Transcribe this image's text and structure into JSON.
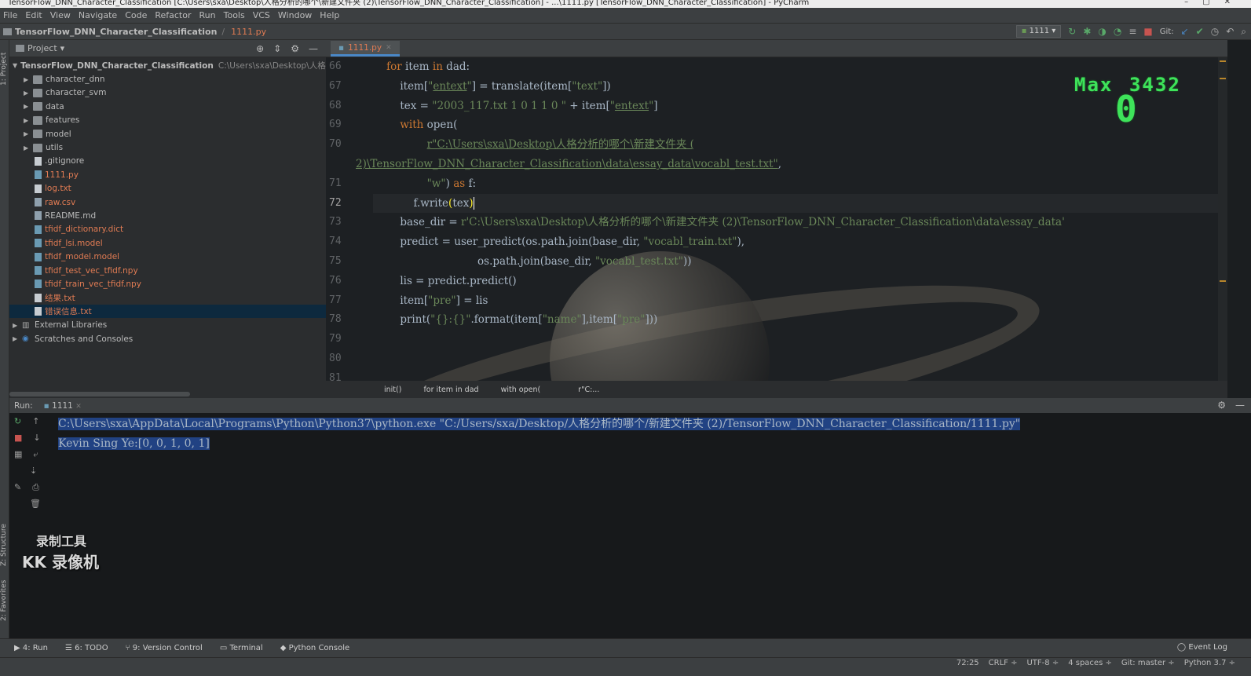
{
  "window": {
    "title": "TensorFlow_DNN_Character_Classification [C:\\Users\\sxa\\Desktop\\人格分析的哪个\\新建文件夹 (2)\\TensorFlow_DNN_Character_Classification] - ...\\1111.py [TensorFlow_DNN_Character_Classification] - PyCharm"
  },
  "menu": [
    "File",
    "Edit",
    "View",
    "Navigate",
    "Code",
    "Refactor",
    "Run",
    "Tools",
    "VCS",
    "Window",
    "Help"
  ],
  "nav": {
    "project": "TensorFlow_DNN_Character_Classification",
    "file": "1111.py",
    "run_config": "1111",
    "git_label": "Git:"
  },
  "left_strip": {
    "project_tab": "1: Project",
    "structure_tab": "Z: Structure",
    "favorites_tab": "2: Favorites"
  },
  "project_panel": {
    "header": "Project",
    "root": {
      "name": "TensorFlow_DNN_Character_Classification",
      "path": "C:\\Users\\sxa\\Desktop\\人格分析的"
    },
    "folders": [
      "character_dnn",
      "character_svm",
      "data",
      "features",
      "model",
      "utils"
    ],
    "files": [
      {
        "name": ".gitignore",
        "modified": false
      },
      {
        "name": "1111.py",
        "modified": true
      },
      {
        "name": "log.txt",
        "modified": true
      },
      {
        "name": "raw.csv",
        "modified": true
      },
      {
        "name": "README.md",
        "modified": false
      },
      {
        "name": "tfidf_dictionary.dict",
        "modified": true
      },
      {
        "name": "tfidf_lsi.model",
        "modified": true
      },
      {
        "name": "tfidf_model.model",
        "modified": true
      },
      {
        "name": "tfidf_test_vec_tfidf.npy",
        "modified": true
      },
      {
        "name": "tfidf_train_vec_tfidf.npy",
        "modified": true
      },
      {
        "name": "结果.txt",
        "modified": true
      },
      {
        "name": "错误信息.txt",
        "modified": true
      }
    ],
    "external": "External Libraries",
    "scratches": "Scratches and Consoles"
  },
  "editor": {
    "tab": "1111.py",
    "line_numbers": [
      "66",
      "67",
      "68",
      "69",
      "70",
      "",
      "71",
      "72",
      "73",
      "74",
      "75",
      "76",
      "77",
      "78",
      "79",
      "80",
      "81"
    ],
    "breadcrumbs": [
      "init()",
      "for item in dad",
      "with open(",
      "r\"C:..."
    ]
  },
  "overlay": {
    "max_label": "Max",
    "max_value": "3432",
    "score": "0"
  },
  "run_panel": {
    "label": "Run:",
    "config": "1111",
    "output": [
      "C:\\Users\\sxa\\AppData\\Local\\Programs\\Python\\Python37\\python.exe \"C:/Users/sxa/Desktop/人格分析的哪个/新建文件夹 (2)/TensorFlow_DNN_Character_Classification/1111.py\"",
      "Kevin Sing Ye:[0, 0, 1, 0, 1]"
    ]
  },
  "watermark": {
    "line1": "录制工具",
    "line2": "KK 录像机"
  },
  "bottom_tools": [
    "4: Run",
    "6: TODO",
    "9: Version Control",
    "Terminal",
    "Python Console"
  ],
  "event_log": "Event Log",
  "status": {
    "position": "72:25",
    "line_sep": "CRLF ÷",
    "encoding": "UTF-8 ÷",
    "indent": "4 spaces ÷",
    "git": "Git: master ÷",
    "interpreter": "Python 3.7 ÷"
  }
}
